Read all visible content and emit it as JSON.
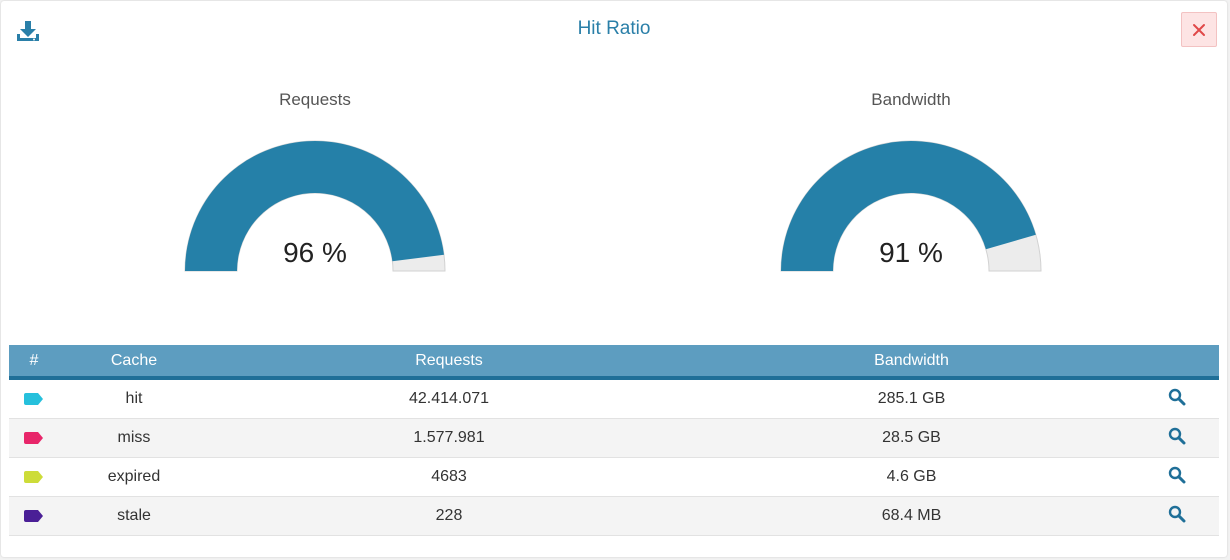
{
  "modal": {
    "title": "Hit Ratio",
    "download_icon": "download-icon",
    "close_icon": "close-icon"
  },
  "colors": {
    "accent": "#2580a8",
    "gauge_bg": "#ececec",
    "header_bg": "#5d9dc0"
  },
  "gauges": [
    {
      "label": "Requests",
      "value_text": "96 %",
      "fraction": 0.96
    },
    {
      "label": "Bandwidth",
      "value_text": "91 %",
      "fraction": 0.91
    }
  ],
  "table": {
    "headers": {
      "num": "#",
      "cache": "Cache",
      "requests": "Requests",
      "bandwidth": "Bandwidth"
    },
    "rows": [
      {
        "color": "#26c0dc",
        "cache": "hit",
        "requests": "42.414.071",
        "bandwidth": "285.1 GB",
        "action_icon": "search-icon"
      },
      {
        "color": "#e8266a",
        "cache": "miss",
        "requests": "1.577.981",
        "bandwidth": "28.5 GB",
        "action_icon": "search-icon"
      },
      {
        "color": "#cddc39",
        "cache": "expired",
        "requests": "4683",
        "bandwidth": "4.6 GB",
        "action_icon": "search-icon"
      },
      {
        "color": "#4a1f96",
        "cache": "stale",
        "requests": "228",
        "bandwidth": "68.4 MB",
        "action_icon": "search-icon"
      }
    ]
  }
}
